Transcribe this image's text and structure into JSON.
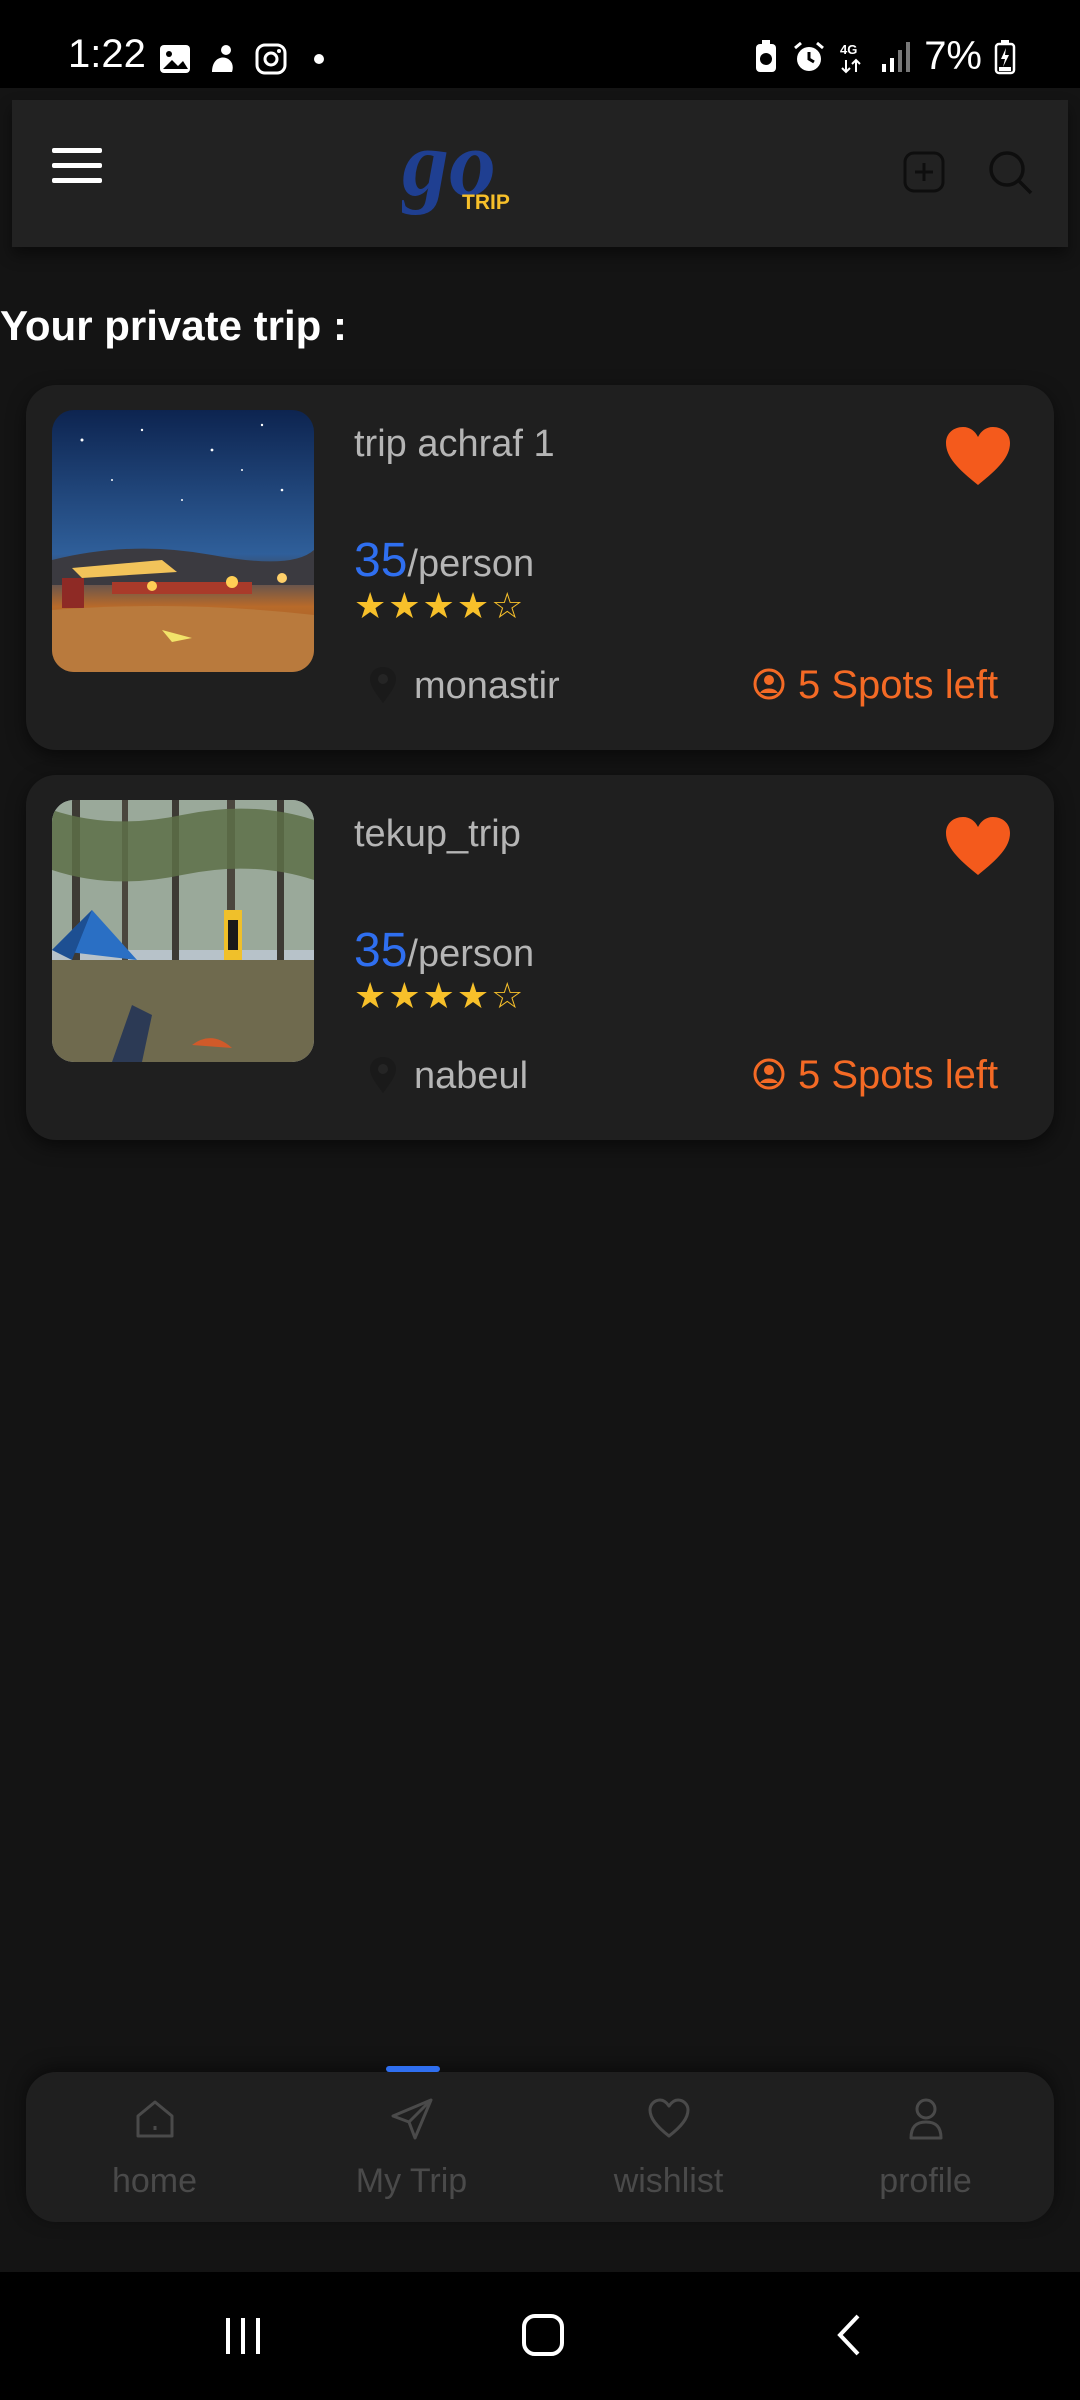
{
  "status_bar": {
    "time": "1:22",
    "battery": "7%",
    "network": "4G"
  },
  "header": {
    "logo_script": "go",
    "logo_word": "TRIP"
  },
  "section_title": "Your private trip :",
  "trips": [
    {
      "name": "trip achraf 1",
      "price": "35",
      "price_unit": "/person",
      "stars": "★★★★☆",
      "location": "monastir",
      "spots": "5 Spots left"
    },
    {
      "name": "tekup_trip",
      "price": "35",
      "price_unit": "/person",
      "stars": "★★★★☆",
      "location": "nabeul",
      "spots": "5 Spots left"
    }
  ],
  "bottom_nav": {
    "active": "My Trip",
    "items": [
      {
        "label": "home",
        "icon": "home-icon"
      },
      {
        "label": "My Trip",
        "icon": "send-icon"
      },
      {
        "label": "wishlist",
        "icon": "heart-icon"
      },
      {
        "label": "profile",
        "icon": "user-icon"
      }
    ]
  },
  "colors": {
    "accent_blue": "#2f6ff0",
    "accent_orange": "#f46a25",
    "star_yellow": "#f7c02a",
    "background": "#141414",
    "card": "#1f1f1f"
  }
}
